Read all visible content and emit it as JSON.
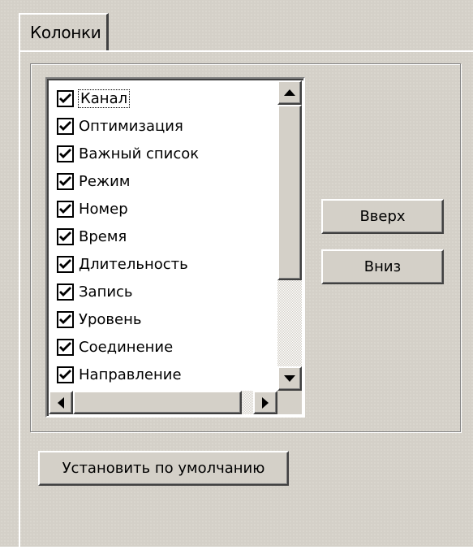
{
  "tabs": [
    {
      "label": "Колонки",
      "active": true
    }
  ],
  "columns_list": {
    "items": [
      {
        "label": "Канал",
        "checked": true
      },
      {
        "label": "Оптимизация",
        "checked": true
      },
      {
        "label": "Важный список",
        "checked": true
      },
      {
        "label": "Режим",
        "checked": true
      },
      {
        "label": "Номер",
        "checked": true
      },
      {
        "label": "Время",
        "checked": true
      },
      {
        "label": "Длительность",
        "checked": true
      },
      {
        "label": "Запись",
        "checked": true
      },
      {
        "label": "Уровень",
        "checked": true
      },
      {
        "label": "Соединение",
        "checked": true
      },
      {
        "label": "Направление",
        "checked": true
      }
    ]
  },
  "buttons": {
    "up": "Вверх",
    "down": "Вниз",
    "defaults": "Установить по умолчанию"
  },
  "icons": {
    "scroll_up": "arrow-up-icon",
    "scroll_down": "arrow-down-icon",
    "scroll_left": "arrow-left-icon",
    "scroll_right": "arrow-right-icon",
    "checkbox_mark": "checkmark-icon"
  },
  "colors": {
    "face": "#d4d0c8",
    "window": "#ffffff",
    "shadow": "#808080",
    "dark_shadow": "#404040",
    "text": "#000000"
  }
}
